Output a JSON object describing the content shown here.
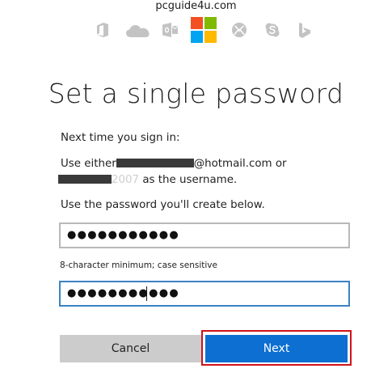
{
  "watermark": "pcguide4u.com",
  "icons": [
    {
      "name": "office-icon",
      "color": "#c3c3c3"
    },
    {
      "name": "onedrive-icon",
      "color": "#c3c3c3"
    },
    {
      "name": "outlook-icon",
      "color": "#c3c3c3"
    },
    {
      "name": "microsoft-logo",
      "colors": [
        "#f25022",
        "#7fba00",
        "#00a4ef",
        "#ffb900"
      ]
    },
    {
      "name": "xbox-icon",
      "color": "#c3c3c3"
    },
    {
      "name": "skype-icon",
      "color": "#c3c3c3"
    },
    {
      "name": "bing-icon",
      "color": "#c3c3c3"
    }
  ],
  "page": {
    "title": "Set a single password",
    "intro": "Next time you sign in:",
    "use_prefix": "Use either",
    "email_suffix": "@hotmail.com or",
    "username_tail": "2007",
    "username_suffix": " as the username.",
    "create_below": "Use the password you'll create below."
  },
  "form": {
    "password_value": "●●●●●●●●●●●",
    "confirm_value": "●●●●●●●●●●●",
    "hint": "8-character minimum; case sensitive"
  },
  "buttons": {
    "cancel": "Cancel",
    "next": "Next"
  },
  "colors": {
    "next_button": "#0d6fd1",
    "cancel_button": "#cccccc",
    "highlight_outline": "#d0121b",
    "focused_border": "#3b82c4"
  }
}
